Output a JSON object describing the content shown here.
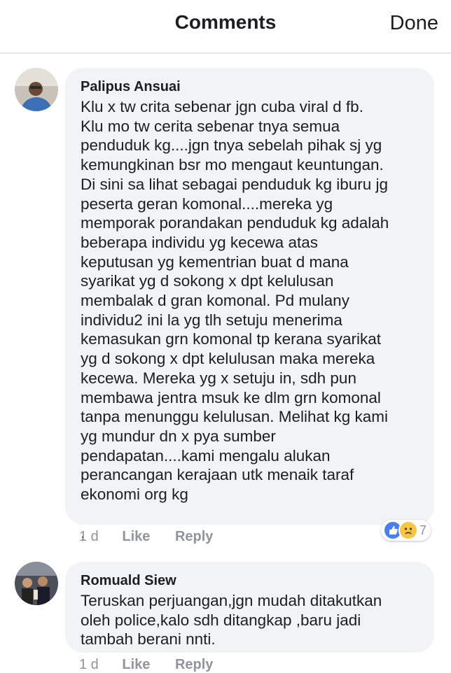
{
  "header": {
    "title": "Comments",
    "done_label": "Done"
  },
  "comments": [
    {
      "author": "Palipus Ansuai",
      "text": "Klu x tw crita sebenar jgn cuba viral d fb.\nKlu mo tw cerita sebenar tnya semua\npenduduk kg....jgn tnya sebelah pihak sj yg\nkemungkinan bsr mo mengaut keuntungan.\nDi sini sa lihat sebagai penduduk kg iburu jg\npeserta geran komonal....mereka yg\nmemporak porandakan penduduk kg adalah\nbeberapa individu yg kecewa atas\nkeputusan yg kementrian buat d mana\nsyarikat yg d sokong x dpt kelulusan\nmembalak d gran komonal. Pd mulany\nindividu2 ini la yg tlh setuju menerima\nkemasukan grn komonal tp kerana syarikat\nyg d sokong x dpt kelulusan maka mereka\nkecewa. Mereka yg x setuju in, sdh pun\nmembawa jentra msuk ke dlm grn komonal\ntanpa menunggu kelulusan. Melihat kg kami\nyg mundur dn x pya sumber\npendapatan....kami mengalu alukan\nperancangan kerajaan utk menaik taraf\nekonomi org kg\n\n,",
      "time": "1 d",
      "like_label": "Like",
      "reply_label": "Reply",
      "reaction_count": "7",
      "reactions": [
        "like-icon",
        "sad-icon"
      ]
    },
    {
      "author": "Romuald Siew",
      "text": "Teruskan perjuangan,jgn mudah ditakutkan\noleh police,kalo sdh ditangkap ,baru jadi\ntambah berani nnti.",
      "time": "1 d",
      "like_label": "Like",
      "reply_label": "Reply"
    }
  ],
  "colors": {
    "bubble": "#f2f3f5",
    "meta": "#90949c",
    "like_blue": "#4a7ff2",
    "sad_yellow": "#f7c644"
  }
}
